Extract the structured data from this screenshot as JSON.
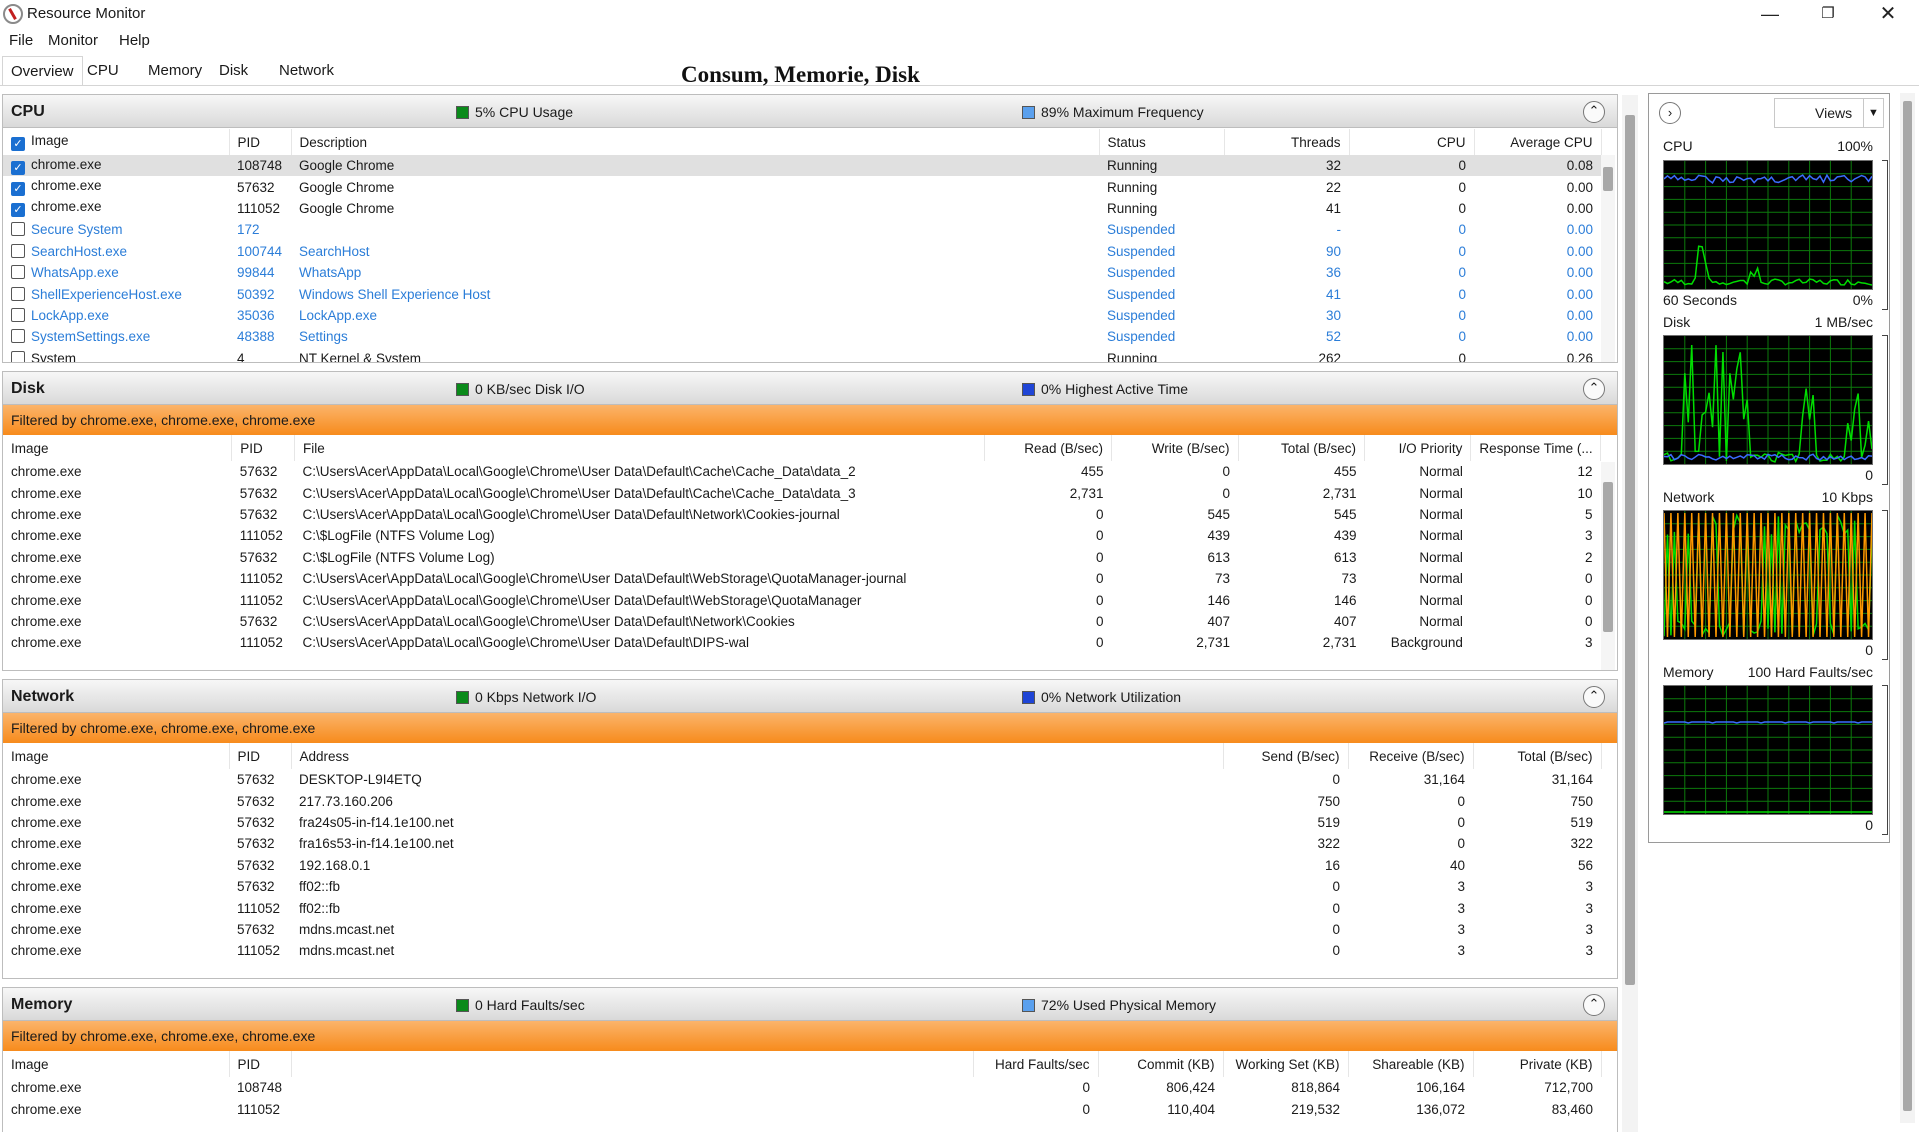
{
  "window": {
    "title": "Resource Monitor"
  },
  "menu": [
    "File",
    "Monitor",
    "Help"
  ],
  "tabs": [
    "Overview",
    "CPU",
    "Memory",
    "Disk",
    "Network"
  ],
  "overlay_caption": "Consum, Memorie, Disk",
  "cpu": {
    "title": "CPU",
    "usage": "5% CPU Usage",
    "frequency": "89% Maximum Frequency",
    "headers": [
      "Image",
      "PID",
      "Description",
      "Status",
      "Threads",
      "CPU",
      "Average CPU"
    ],
    "rows": [
      {
        "image": "chrome.exe",
        "pid": "108748",
        "desc": "Google Chrome",
        "status": "Running",
        "threads": "32",
        "cpu": "0",
        "avg": "0.08"
      },
      {
        "image": "chrome.exe",
        "pid": "57632",
        "desc": "Google Chrome",
        "status": "Running",
        "threads": "22",
        "cpu": "0",
        "avg": "0.00"
      },
      {
        "image": "chrome.exe",
        "pid": "111052",
        "desc": "Google Chrome",
        "status": "Running",
        "threads": "41",
        "cpu": "0",
        "avg": "0.00"
      },
      {
        "image": "Secure System",
        "pid": "172",
        "desc": "",
        "status": "Suspended",
        "threads": "-",
        "cpu": "0",
        "avg": "0.00"
      },
      {
        "image": "SearchHost.exe",
        "pid": "100744",
        "desc": "SearchHost",
        "status": "Suspended",
        "threads": "90",
        "cpu": "0",
        "avg": "0.00"
      },
      {
        "image": "WhatsApp.exe",
        "pid": "99844",
        "desc": "WhatsApp",
        "status": "Suspended",
        "threads": "36",
        "cpu": "0",
        "avg": "0.00"
      },
      {
        "image": "ShellExperienceHost.exe",
        "pid": "50392",
        "desc": "Windows Shell Experience Host",
        "status": "Suspended",
        "threads": "41",
        "cpu": "0",
        "avg": "0.00"
      },
      {
        "image": "LockApp.exe",
        "pid": "35036",
        "desc": "LockApp.exe",
        "status": "Suspended",
        "threads": "30",
        "cpu": "0",
        "avg": "0.00"
      },
      {
        "image": "SystemSettings.exe",
        "pid": "48388",
        "desc": "Settings",
        "status": "Suspended",
        "threads": "52",
        "cpu": "0",
        "avg": "0.00"
      },
      {
        "image": "System",
        "pid": "4",
        "desc": "NT Kernel & System",
        "status": "Running",
        "threads": "262",
        "cpu": "0",
        "avg": "0.26"
      }
    ]
  },
  "disk": {
    "title": "Disk",
    "io": "0 KB/sec Disk I/O",
    "active": "0% Highest Active Time",
    "filter": "Filtered by chrome.exe, chrome.exe, chrome.exe",
    "headers": [
      "Image",
      "PID",
      "File",
      "Read (B/sec)",
      "Write (B/sec)",
      "Total (B/sec)",
      "I/O Priority",
      "Response Time (..."
    ],
    "rows": [
      {
        "image": "chrome.exe",
        "pid": "57632",
        "file": "C:\\Users\\Acer\\AppData\\Local\\Google\\Chrome\\User Data\\Default\\Cache\\Cache_Data\\data_2",
        "read": "455",
        "write": "0",
        "total": "455",
        "prio": "Normal",
        "resp": "12"
      },
      {
        "image": "chrome.exe",
        "pid": "57632",
        "file": "C:\\Users\\Acer\\AppData\\Local\\Google\\Chrome\\User Data\\Default\\Cache\\Cache_Data\\data_3",
        "read": "2,731",
        "write": "0",
        "total": "2,731",
        "prio": "Normal",
        "resp": "10"
      },
      {
        "image": "chrome.exe",
        "pid": "57632",
        "file": "C:\\Users\\Acer\\AppData\\Local\\Google\\Chrome\\User Data\\Default\\Network\\Cookies-journal",
        "read": "0",
        "write": "545",
        "total": "545",
        "prio": "Normal",
        "resp": "5"
      },
      {
        "image": "chrome.exe",
        "pid": "111052",
        "file": "C:\\$LogFile (NTFS Volume Log)",
        "read": "0",
        "write": "439",
        "total": "439",
        "prio": "Normal",
        "resp": "3"
      },
      {
        "image": "chrome.exe",
        "pid": "57632",
        "file": "C:\\$LogFile (NTFS Volume Log)",
        "read": "0",
        "write": "613",
        "total": "613",
        "prio": "Normal",
        "resp": "2"
      },
      {
        "image": "chrome.exe",
        "pid": "111052",
        "file": "C:\\Users\\Acer\\AppData\\Local\\Google\\Chrome\\User Data\\Default\\WebStorage\\QuotaManager-journal",
        "read": "0",
        "write": "73",
        "total": "73",
        "prio": "Normal",
        "resp": "0"
      },
      {
        "image": "chrome.exe",
        "pid": "111052",
        "file": "C:\\Users\\Acer\\AppData\\Local\\Google\\Chrome\\User Data\\Default\\WebStorage\\QuotaManager",
        "read": "0",
        "write": "146",
        "total": "146",
        "prio": "Normal",
        "resp": "0"
      },
      {
        "image": "chrome.exe",
        "pid": "57632",
        "file": "C:\\Users\\Acer\\AppData\\Local\\Google\\Chrome\\User Data\\Default\\Network\\Cookies",
        "read": "0",
        "write": "407",
        "total": "407",
        "prio": "Normal",
        "resp": "0"
      },
      {
        "image": "chrome.exe",
        "pid": "111052",
        "file": "C:\\Users\\Acer\\AppData\\Local\\Google\\Chrome\\User Data\\Default\\DIPS-wal",
        "read": "0",
        "write": "2,731",
        "total": "2,731",
        "prio": "Background",
        "resp": "3"
      }
    ]
  },
  "network": {
    "title": "Network",
    "io": "0 Kbps Network I/O",
    "util": "0% Network Utilization",
    "filter": "Filtered by chrome.exe, chrome.exe, chrome.exe",
    "headers": [
      "Image",
      "PID",
      "Address",
      "Send (B/sec)",
      "Receive (B/sec)",
      "Total (B/sec)"
    ],
    "rows": [
      {
        "image": "chrome.exe",
        "pid": "57632",
        "addr": "DESKTOP-L9I4ETQ",
        "send": "0",
        "recv": "31,164",
        "total": "31,164"
      },
      {
        "image": "chrome.exe",
        "pid": "57632",
        "addr": "217.73.160.206",
        "send": "750",
        "recv": "0",
        "total": "750"
      },
      {
        "image": "chrome.exe",
        "pid": "57632",
        "addr": "fra24s05-in-f14.1e100.net",
        "send": "519",
        "recv": "0",
        "total": "519"
      },
      {
        "image": "chrome.exe",
        "pid": "57632",
        "addr": "fra16s53-in-f14.1e100.net",
        "send": "322",
        "recv": "0",
        "total": "322"
      },
      {
        "image": "chrome.exe",
        "pid": "57632",
        "addr": "192.168.0.1",
        "send": "16",
        "recv": "40",
        "total": "56"
      },
      {
        "image": "chrome.exe",
        "pid": "57632",
        "addr": "ff02::fb",
        "send": "0",
        "recv": "3",
        "total": "3"
      },
      {
        "image": "chrome.exe",
        "pid": "111052",
        "addr": "ff02::fb",
        "send": "0",
        "recv": "3",
        "total": "3"
      },
      {
        "image": "chrome.exe",
        "pid": "57632",
        "addr": "mdns.mcast.net",
        "send": "0",
        "recv": "3",
        "total": "3"
      },
      {
        "image": "chrome.exe",
        "pid": "111052",
        "addr": "mdns.mcast.net",
        "send": "0",
        "recv": "3",
        "total": "3"
      }
    ]
  },
  "memory": {
    "title": "Memory",
    "faults": "0 Hard Faults/sec",
    "used": "72% Used Physical Memory",
    "filter": "Filtered by chrome.exe, chrome.exe, chrome.exe",
    "headers": [
      "Image",
      "PID",
      "Hard Faults/sec",
      "Commit (KB)",
      "Working Set (KB)",
      "Shareable (KB)",
      "Private (KB)"
    ],
    "rows": [
      {
        "image": "chrome.exe",
        "pid": "108748",
        "faults": "0",
        "commit": "806,424",
        "ws": "818,864",
        "share": "106,164",
        "priv": "712,700"
      },
      {
        "image": "chrome.exe",
        "pid": "111052",
        "faults": "0",
        "commit": "110,404",
        "ws": "219,532",
        "share": "136,072",
        "priv": "83,460"
      }
    ]
  },
  "side": {
    "views": "Views",
    "cpu": {
      "label": "CPU",
      "max": "100%",
      "foot_left": "60 Seconds",
      "foot_right": "0%"
    },
    "disk": {
      "label": "Disk",
      "max": "1 MB/sec",
      "foot_right": "0"
    },
    "network": {
      "label": "Network",
      "max": "10 Kbps",
      "foot_right": "0"
    },
    "memory": {
      "label": "Memory",
      "max": "100 Hard Faults/sec",
      "foot_right": "0"
    }
  },
  "colors": {
    "filter_orange": "#f78b1c",
    "graph_green": "#00dd00",
    "graph_blue": "#3b6cff",
    "graph_orange": "#ff9900",
    "link_blue": "#2b7dd8"
  }
}
